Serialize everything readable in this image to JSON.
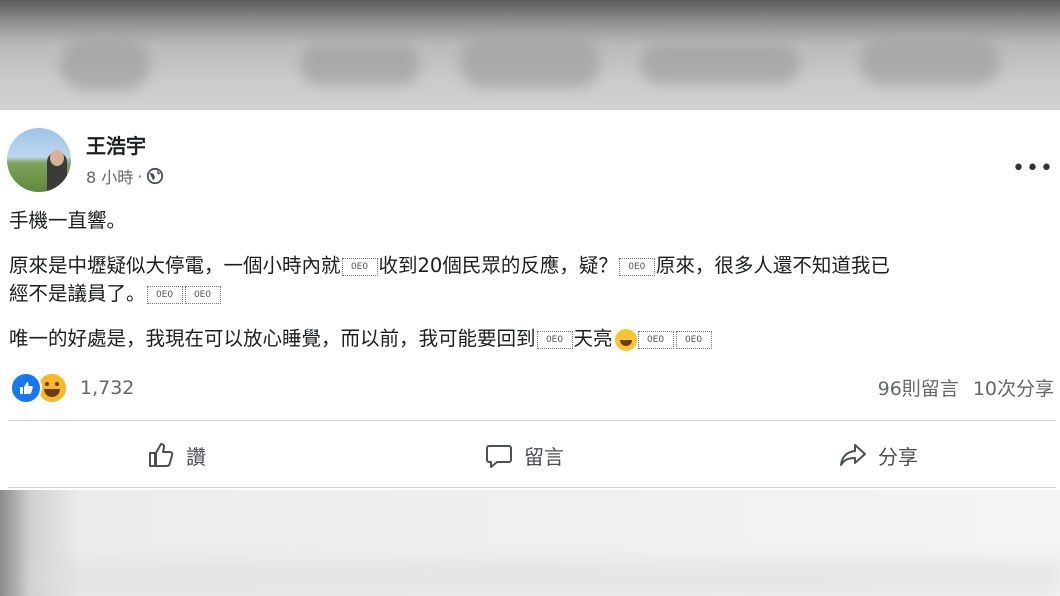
{
  "post": {
    "author": "王浩宇",
    "time": "8 小時",
    "meta_separator": "·",
    "more_label": "•••",
    "lines": [
      "手機一直響。",
      "原來是中壢疑似大停電，一個小時內就",
      "收到20個民眾的反應，疑？",
      "原來，很多人還不知道我已",
      "經不是議員了。",
      "唯一的好處是，我現在可以放心睡覺，而以前，我可能要回到",
      "天亮"
    ],
    "glyph_placeholder": "0E0",
    "reaction_count": "1,732",
    "comments": "96則留言",
    "shares": "10次分享",
    "actions": {
      "like": "讚",
      "comment": "留言",
      "share": "分享"
    }
  },
  "colors": {
    "like_blue": "#1877f2",
    "haha_yellow": "#f7b928",
    "meta_gray": "#65676b"
  },
  "icons": [
    "globe-icon",
    "more-icon",
    "like-reaction-icon",
    "haha-reaction-icon",
    "like-icon",
    "comment-icon",
    "share-icon"
  ]
}
